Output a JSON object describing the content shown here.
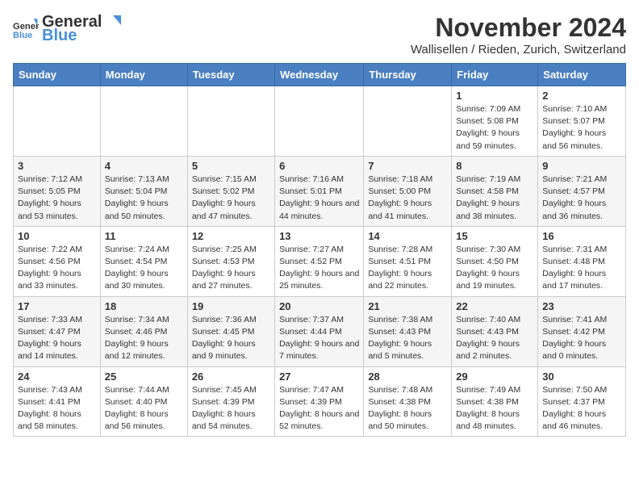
{
  "logo": {
    "general": "General",
    "blue": "Blue"
  },
  "title": "November 2024",
  "location": "Wallisellen / Rieden, Zurich, Switzerland",
  "headers": [
    "Sunday",
    "Monday",
    "Tuesday",
    "Wednesday",
    "Thursday",
    "Friday",
    "Saturday"
  ],
  "weeks": [
    [
      {
        "day": "",
        "info": ""
      },
      {
        "day": "",
        "info": ""
      },
      {
        "day": "",
        "info": ""
      },
      {
        "day": "",
        "info": ""
      },
      {
        "day": "",
        "info": ""
      },
      {
        "day": "1",
        "info": "Sunrise: 7:09 AM\nSunset: 5:08 PM\nDaylight: 9 hours and 59 minutes."
      },
      {
        "day": "2",
        "info": "Sunrise: 7:10 AM\nSunset: 5:07 PM\nDaylight: 9 hours and 56 minutes."
      }
    ],
    [
      {
        "day": "3",
        "info": "Sunrise: 7:12 AM\nSunset: 5:05 PM\nDaylight: 9 hours and 53 minutes."
      },
      {
        "day": "4",
        "info": "Sunrise: 7:13 AM\nSunset: 5:04 PM\nDaylight: 9 hours and 50 minutes."
      },
      {
        "day": "5",
        "info": "Sunrise: 7:15 AM\nSunset: 5:02 PM\nDaylight: 9 hours and 47 minutes."
      },
      {
        "day": "6",
        "info": "Sunrise: 7:16 AM\nSunset: 5:01 PM\nDaylight: 9 hours and 44 minutes."
      },
      {
        "day": "7",
        "info": "Sunrise: 7:18 AM\nSunset: 5:00 PM\nDaylight: 9 hours and 41 minutes."
      },
      {
        "day": "8",
        "info": "Sunrise: 7:19 AM\nSunset: 4:58 PM\nDaylight: 9 hours and 38 minutes."
      },
      {
        "day": "9",
        "info": "Sunrise: 7:21 AM\nSunset: 4:57 PM\nDaylight: 9 hours and 36 minutes."
      }
    ],
    [
      {
        "day": "10",
        "info": "Sunrise: 7:22 AM\nSunset: 4:56 PM\nDaylight: 9 hours and 33 minutes."
      },
      {
        "day": "11",
        "info": "Sunrise: 7:24 AM\nSunset: 4:54 PM\nDaylight: 9 hours and 30 minutes."
      },
      {
        "day": "12",
        "info": "Sunrise: 7:25 AM\nSunset: 4:53 PM\nDaylight: 9 hours and 27 minutes."
      },
      {
        "day": "13",
        "info": "Sunrise: 7:27 AM\nSunset: 4:52 PM\nDaylight: 9 hours and 25 minutes."
      },
      {
        "day": "14",
        "info": "Sunrise: 7:28 AM\nSunset: 4:51 PM\nDaylight: 9 hours and 22 minutes."
      },
      {
        "day": "15",
        "info": "Sunrise: 7:30 AM\nSunset: 4:50 PM\nDaylight: 9 hours and 19 minutes."
      },
      {
        "day": "16",
        "info": "Sunrise: 7:31 AM\nSunset: 4:48 PM\nDaylight: 9 hours and 17 minutes."
      }
    ],
    [
      {
        "day": "17",
        "info": "Sunrise: 7:33 AM\nSunset: 4:47 PM\nDaylight: 9 hours and 14 minutes."
      },
      {
        "day": "18",
        "info": "Sunrise: 7:34 AM\nSunset: 4:46 PM\nDaylight: 9 hours and 12 minutes."
      },
      {
        "day": "19",
        "info": "Sunrise: 7:36 AM\nSunset: 4:45 PM\nDaylight: 9 hours and 9 minutes."
      },
      {
        "day": "20",
        "info": "Sunrise: 7:37 AM\nSunset: 4:44 PM\nDaylight: 9 hours and 7 minutes."
      },
      {
        "day": "21",
        "info": "Sunrise: 7:38 AM\nSunset: 4:43 PM\nDaylight: 9 hours and 5 minutes."
      },
      {
        "day": "22",
        "info": "Sunrise: 7:40 AM\nSunset: 4:43 PM\nDaylight: 9 hours and 2 minutes."
      },
      {
        "day": "23",
        "info": "Sunrise: 7:41 AM\nSunset: 4:42 PM\nDaylight: 9 hours and 0 minutes."
      }
    ],
    [
      {
        "day": "24",
        "info": "Sunrise: 7:43 AM\nSunset: 4:41 PM\nDaylight: 8 hours and 58 minutes."
      },
      {
        "day": "25",
        "info": "Sunrise: 7:44 AM\nSunset: 4:40 PM\nDaylight: 8 hours and 56 minutes."
      },
      {
        "day": "26",
        "info": "Sunrise: 7:45 AM\nSunset: 4:39 PM\nDaylight: 8 hours and 54 minutes."
      },
      {
        "day": "27",
        "info": "Sunrise: 7:47 AM\nSunset: 4:39 PM\nDaylight: 8 hours and 52 minutes."
      },
      {
        "day": "28",
        "info": "Sunrise: 7:48 AM\nSunset: 4:38 PM\nDaylight: 8 hours and 50 minutes."
      },
      {
        "day": "29",
        "info": "Sunrise: 7:49 AM\nSunset: 4:38 PM\nDaylight: 8 hours and 48 minutes."
      },
      {
        "day": "30",
        "info": "Sunrise: 7:50 AM\nSunset: 4:37 PM\nDaylight: 8 hours and 46 minutes."
      }
    ]
  ]
}
